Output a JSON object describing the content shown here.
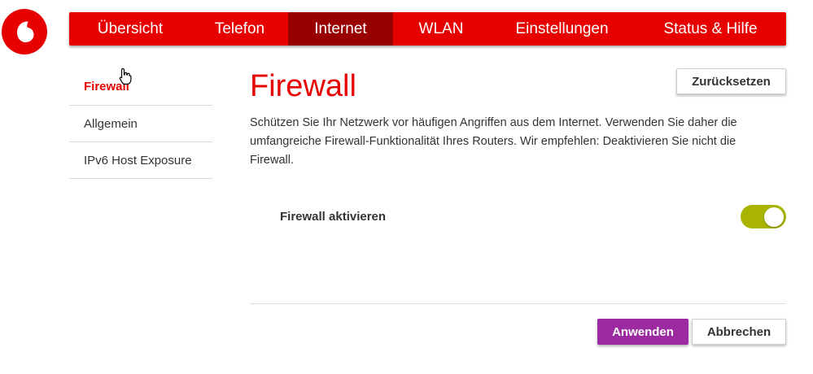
{
  "brand": {
    "logo": "vodafone-logo",
    "accent": "#e60000",
    "active_nav_bg": "#990000"
  },
  "nav": {
    "items": [
      {
        "label": "Übersicht",
        "active": false
      },
      {
        "label": "Telefon",
        "active": false
      },
      {
        "label": "Internet",
        "active": true
      },
      {
        "label": "WLAN",
        "active": false
      },
      {
        "label": "Einstellungen",
        "active": false
      },
      {
        "label": "Status & Hilfe",
        "active": false
      }
    ]
  },
  "sidebar": {
    "items": [
      {
        "label": "Firewall",
        "active": true
      },
      {
        "label": "Allgemein",
        "active": false
      },
      {
        "label": "IPv6 Host Exposure",
        "active": false
      }
    ]
  },
  "main": {
    "title": "Firewall",
    "reset_label": "Zurücksetzen",
    "description": "Schützen Sie Ihr Netzwerk vor häufigen Angriffen aus dem Internet. Verwenden Sie daher die umfangreiche Firewall-Funktionalität Ihres Routers. Wir empfehlen: Deaktivieren Sie nicht die Firewall.",
    "toggle": {
      "label": "Firewall aktivieren",
      "enabled": true,
      "color": "#a8b400"
    }
  },
  "footer": {
    "apply_label": "Anwenden",
    "apply_color": "#9c2aa0",
    "cancel_label": "Abbrechen"
  },
  "cursor_icon": "hand-pointer-icon"
}
